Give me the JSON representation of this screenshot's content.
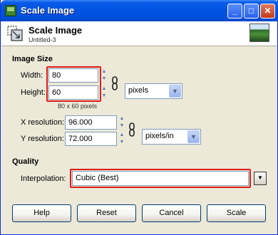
{
  "window": {
    "title": "Scale Image",
    "minimize": "_",
    "maximize": "□",
    "close": "✕"
  },
  "header": {
    "title": "Scale Image",
    "subtitle": "Untitled-3"
  },
  "image_size": {
    "section": "Image Size",
    "width_label": "Width:",
    "width_value": "80",
    "height_label": "Height:",
    "height_value": "60",
    "size_note": "80 x 60 pixels",
    "unit": "pixels"
  },
  "resolution": {
    "x_label": "X resolution:",
    "x_value": "96.000",
    "y_label": "Y resolution:",
    "y_value": "72.000",
    "unit": "pixels/in"
  },
  "quality": {
    "section": "Quality",
    "interp_label": "Interpolation:",
    "interp_value": "Cubic (Best)"
  },
  "buttons": {
    "help": "Help",
    "reset": "Reset",
    "cancel": "Cancel",
    "scale": "Scale"
  },
  "colors": {
    "highlight": "#e01b1b",
    "title_bar": "#0053e1"
  }
}
